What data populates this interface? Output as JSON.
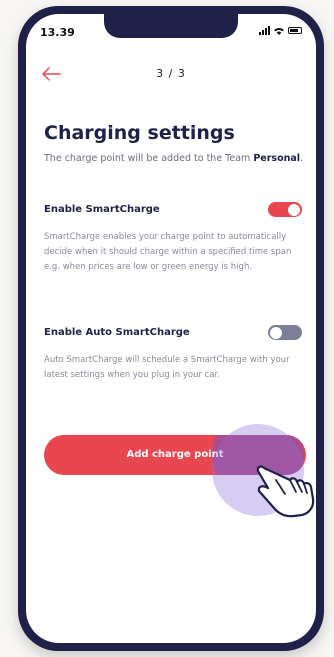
{
  "status_bar": {
    "time": "13.39",
    "icons": [
      "signal-icon",
      "wifi-icon",
      "battery-icon"
    ]
  },
  "header": {
    "back_icon": "arrow-left-icon",
    "step": "3 / 3"
  },
  "page": {
    "title": "Charging settings",
    "subtitle_prefix": "The charge point will be added to the Team",
    "team_name": "Personal",
    "subtitle_suffix": "."
  },
  "smartcharge": {
    "label": "Enable SmartCharge",
    "enabled": true,
    "description": "SmartCharge enables your charge point to automatically decide when it should charge within a specified time span e.g. when prices are low or green energy is high."
  },
  "auto_smartcharge": {
    "label": "Enable Auto SmartCharge",
    "enabled": false,
    "description": "Auto SmartCharge will schedule a SmartCharge with your latest settings when you plug in your car."
  },
  "cta": {
    "label": "Add charge point"
  },
  "colors": {
    "accent": "#e9474f",
    "navy": "#1f2148",
    "toggle_off": "#7d7f97",
    "tap_glow": "#8c6ed7"
  }
}
